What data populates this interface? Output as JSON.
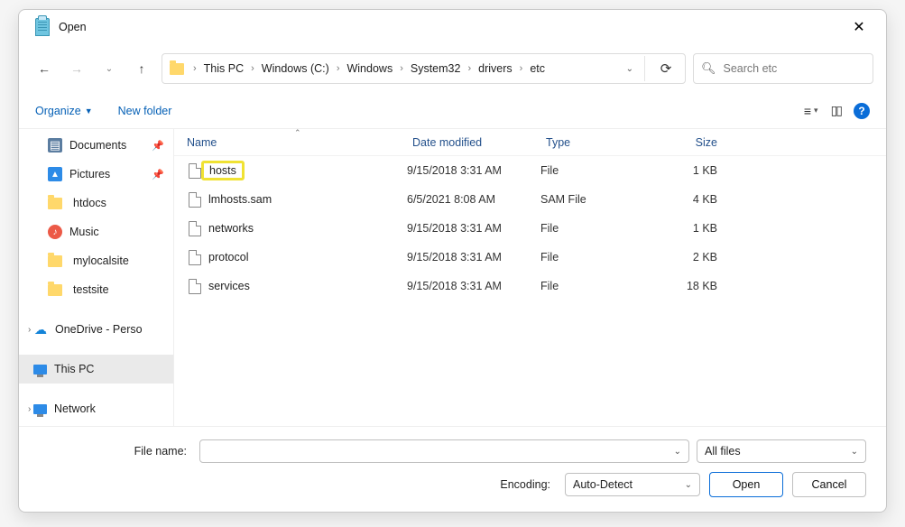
{
  "title": "Open",
  "breadcrumbs": [
    "This PC",
    "Windows (C:)",
    "Windows",
    "System32",
    "drivers",
    "etc"
  ],
  "search": {
    "placeholder": "Search etc"
  },
  "toolbar": {
    "organize": "Organize",
    "newfolder": "New folder"
  },
  "sidebar": {
    "items": [
      {
        "label": "Documents",
        "icon": "doc",
        "pinned": true
      },
      {
        "label": "Pictures",
        "icon": "pic",
        "pinned": true
      },
      {
        "label": "htdocs",
        "icon": "folder"
      },
      {
        "label": "Music",
        "icon": "music"
      },
      {
        "label": "mylocalsite",
        "icon": "folder"
      },
      {
        "label": "testsite",
        "icon": "folder"
      }
    ],
    "onedrive": "OneDrive - Perso",
    "thispc": "This PC",
    "network": "Network"
  },
  "columns": {
    "name": "Name",
    "date": "Date modified",
    "type": "Type",
    "size": "Size"
  },
  "files": [
    {
      "name": "hosts",
      "date": "9/15/2018 3:31 AM",
      "type": "File",
      "size": "1 KB",
      "highlight": true
    },
    {
      "name": "lmhosts.sam",
      "date": "6/5/2021 8:08 AM",
      "type": "SAM File",
      "size": "4 KB"
    },
    {
      "name": "networks",
      "date": "9/15/2018 3:31 AM",
      "type": "File",
      "size": "1 KB"
    },
    {
      "name": "protocol",
      "date": "9/15/2018 3:31 AM",
      "type": "File",
      "size": "2 KB"
    },
    {
      "name": "services",
      "date": "9/15/2018 3:31 AM",
      "type": "File",
      "size": "18 KB"
    }
  ],
  "bottom": {
    "filename_label": "File name:",
    "filename_value": "",
    "filter": "All files",
    "encoding_label": "Encoding:",
    "encoding_value": "Auto-Detect",
    "open": "Open",
    "cancel": "Cancel"
  }
}
